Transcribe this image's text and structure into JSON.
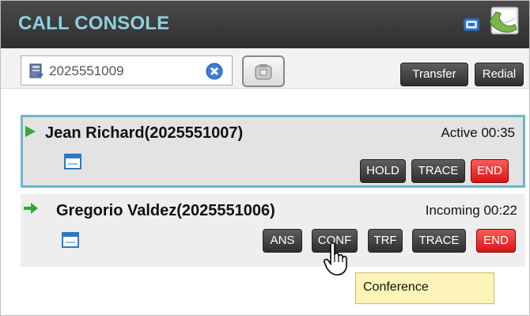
{
  "header": {
    "title": "CALL CONSOLE",
    "icons": [
      "headset-status-icon",
      "phone-book-icon"
    ]
  },
  "dialer": {
    "number": "2025551009",
    "icons": [
      "directory-icon",
      "clear-icon",
      "dial-phone-icon"
    ]
  },
  "toolbar": {
    "transfer_label": "Transfer",
    "redial_label": "Redial"
  },
  "calls": [
    {
      "name": "Jean Richard(2025551007)",
      "status": "Active 00:35",
      "buttons": {
        "hold": "HOLD",
        "trace": "TRACE",
        "end": "END"
      }
    },
    {
      "name": "Gregorio Valdez(2025551006)",
      "status": "Incoming 00:22",
      "buttons": {
        "ans": "ANS",
        "conf": "CONF",
        "trf": "TRF",
        "trace": "TRACE",
        "end": "END"
      }
    }
  ],
  "tooltip": {
    "text": "Conference"
  },
  "colors": {
    "header_bg": "#3a3a3a",
    "title": "#8fd0e0",
    "active_border": "#6bb7c9",
    "end_button": "#e02020",
    "tooltip_bg": "#fbf3b8"
  }
}
